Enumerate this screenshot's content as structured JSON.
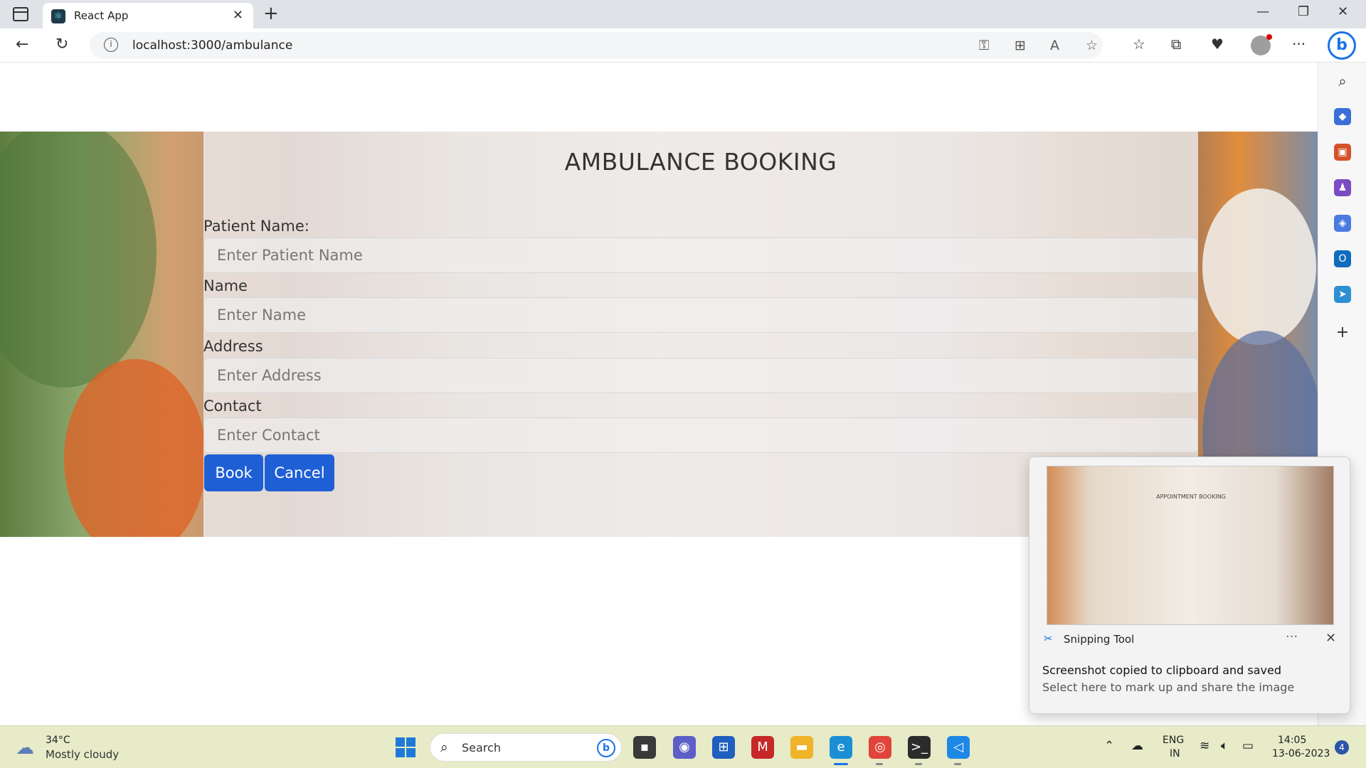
{
  "browser": {
    "tab_title": "React App",
    "tab_favicon": "react-icon",
    "url": "localhost:3000/ambulance"
  },
  "page": {
    "form_title": "AMBULANCE BOOKING",
    "fields": [
      {
        "label": "Patient Name:",
        "placeholder": "Enter Patient Name"
      },
      {
        "label": "Name",
        "placeholder": "Enter  Name"
      },
      {
        "label": "Address",
        "placeholder": "Enter Address"
      },
      {
        "label": "Contact",
        "placeholder": "Enter Contact"
      }
    ],
    "buttons": {
      "book": "Book",
      "cancel": "Cancel"
    },
    "button_color": "#1f5fd6"
  },
  "toast": {
    "thumbnail_title": "APPOINTMENT BOOKING",
    "app_name": "Snipping Tool",
    "message": "Screenshot copied to clipboard and saved",
    "subtext": "Select here to mark up and share the image"
  },
  "taskbar": {
    "weather_temp": "34°C",
    "weather_desc": "Mostly cloudy",
    "search_label": "Search",
    "lang_1": "ENG",
    "lang_2": "IN",
    "time": "14:05",
    "date": "13-06-2023",
    "notification_count": "4"
  }
}
